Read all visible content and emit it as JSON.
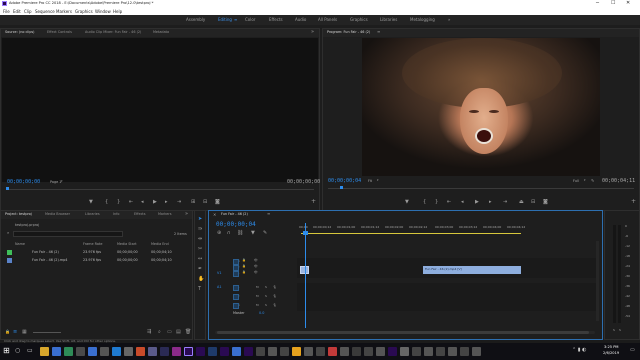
{
  "window": {
    "title": "Adobe Premiere Pro CC 2018 - E:\\Documents\\Adobe\\Premiere Pro\\12.0\\testproj *",
    "controls": [
      "─",
      "☐",
      "✕"
    ]
  },
  "menu": [
    "File",
    "Edit",
    "Clip",
    "Sequence",
    "Markers",
    "Graphics",
    "Window",
    "Help"
  ],
  "workspaces": {
    "items": [
      "Assembly",
      "Editing",
      "Color",
      "Effects",
      "Audio",
      "All Panels",
      "Graphics",
      "Libraries",
      "Metalogging"
    ],
    "active_index": 1,
    "menu_glyph": "≡",
    "more_glyph": "»"
  },
  "source_panel": {
    "tabs": [
      "Source: (no clips)",
      "Effect Controls",
      "Audio Clip Mixer: Fun Fair - 46 (2)",
      "Metadata"
    ],
    "active_tab": 0,
    "timecode_left": "00;00;00;00",
    "page": "Page 1",
    "timecode_right": "00;00;00;00"
  },
  "program_panel": {
    "tab": "Program: Fun Fair - 46 (2)",
    "timecode_left": "00;00;00;04",
    "fit": "Fit",
    "quality": "Full",
    "timecode_right": "00;00;04;11"
  },
  "project_panel": {
    "tabs": [
      "Project: testproj",
      "Media Browser",
      "Libraries",
      "Info",
      "Effects",
      "Markers"
    ],
    "project_file": "testproj.prproj",
    "item_count": "2 Items",
    "columns": [
      "Name",
      "Frame Rate",
      "Media Start",
      "Media End"
    ],
    "rows": [
      {
        "name": "Fun Fair - 46 (2)",
        "rate": "23.976 fps",
        "start": "00;00;00;00",
        "end": "00;00;04;10",
        "color": "#3fbf5a"
      },
      {
        "name": "Fun Fair - 46 (2).mp4",
        "rate": "23.976 fps",
        "start": "00;00;00;00",
        "end": "00;00;04;10",
        "color": "#5a82c8"
      }
    ]
  },
  "timeline": {
    "tab": "Fun Fair - 46 (2)",
    "timecode": "00;00;00;04",
    "ruler": [
      "00;00",
      "00;00;00;12",
      "00;00;01;00",
      "00;00;01;12",
      "00;00;02;00",
      "00;00;02;12",
      "00;00;03;00",
      "00;00;03;12",
      "00;00;04;00",
      "00;00;04;12"
    ],
    "video_tracks": [
      "V3",
      "V2",
      "V1"
    ],
    "audio_tracks": [
      "A1",
      "A2",
      "A3"
    ],
    "master_label": "Master",
    "master_value": "0.0",
    "clip_label": "Fun Fair - 46 (2).mp4 [V]",
    "source_patch_v": "V1",
    "source_patch_a": "A1"
  },
  "status_bar": "Click and drag to marquee select. Use Shift, Alt, and Ctrl for other options.",
  "meters": [
    "0",
    "-6",
    "-12",
    "-18",
    "-24",
    "-30",
    "-36",
    "-42",
    "-48",
    "-54"
  ],
  "clock": {
    "time": "3:25 PM",
    "date": "2/6/2019"
  },
  "colors": {
    "accent": "#2d8ceb",
    "clip": "#8eaede",
    "work_area": "#d7c73c",
    "taskbar": "#0f0f14"
  }
}
